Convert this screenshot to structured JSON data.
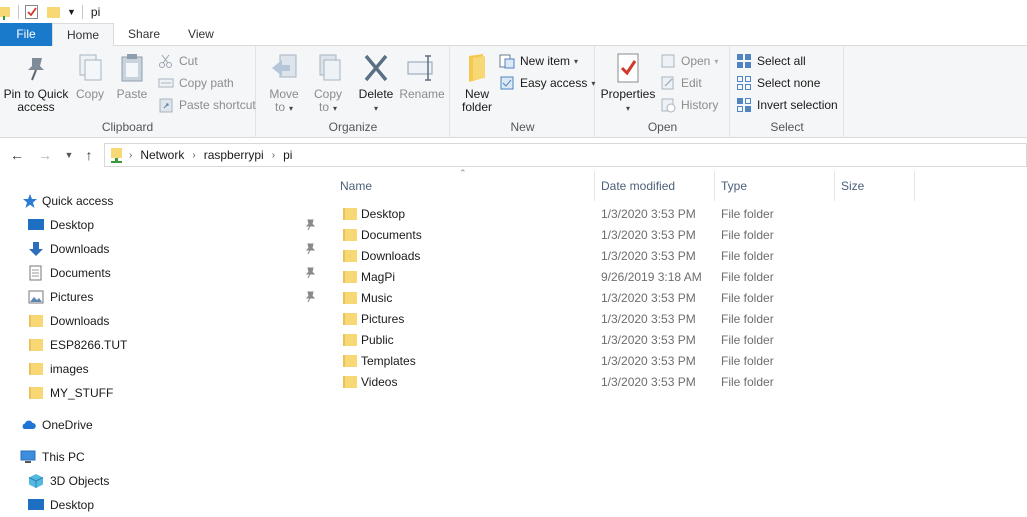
{
  "window": {
    "title": "pi"
  },
  "tabs": [
    {
      "label": "File"
    },
    {
      "label": "Home"
    },
    {
      "label": "Share"
    },
    {
      "label": "View"
    }
  ],
  "ribbon": {
    "clipboard": {
      "label": "Clipboard",
      "pin_label": "Pin to Quick access",
      "copy_label": "Copy",
      "paste_label": "Paste",
      "cut_label": "Cut",
      "copy_path_label": "Copy path",
      "paste_shortcut_label": "Paste shortcut"
    },
    "organize": {
      "label": "Organize",
      "move_label": "Move to",
      "copy_to_label": "Copy to",
      "delete_label": "Delete",
      "rename_label": "Rename"
    },
    "new": {
      "label": "New",
      "new_folder_label": "New folder",
      "new_item_label": "New item",
      "easy_access_label": "Easy access"
    },
    "open": {
      "label": "Open",
      "properties_label": "Properties",
      "open_label": "Open",
      "edit_label": "Edit",
      "history_label": "History"
    },
    "select": {
      "label": "Select",
      "select_all_label": "Select all",
      "select_none_label": "Select none",
      "invert_label": "Invert selection"
    }
  },
  "address": {
    "crumbs": [
      "Network",
      "raspberrypi",
      "pi"
    ]
  },
  "navpane": {
    "quick_access": "Quick access",
    "items": [
      {
        "label": "Desktop",
        "icon": "desktop-icon",
        "pinned": true
      },
      {
        "label": "Downloads",
        "icon": "downloads-icon",
        "pinned": true
      },
      {
        "label": "Documents",
        "icon": "documents-icon",
        "pinned": true
      },
      {
        "label": "Pictures",
        "icon": "pictures-icon",
        "pinned": true
      },
      {
        "label": "Downloads",
        "icon": "folder-icon",
        "pinned": false
      },
      {
        "label": "ESP8266.TUT",
        "icon": "folder-icon",
        "pinned": false
      },
      {
        "label": "images",
        "icon": "folder-icon",
        "pinned": false
      },
      {
        "label": "MY_STUFF",
        "icon": "folder-icon",
        "pinned": false
      }
    ],
    "onedrive": "OneDrive",
    "this_pc": "This PC",
    "pc_items": [
      {
        "label": "3D Objects",
        "icon": "3d-objects-icon"
      },
      {
        "label": "Desktop",
        "icon": "desktop-icon"
      }
    ]
  },
  "columns": {
    "name": "Name",
    "date": "Date modified",
    "type": "Type",
    "size": "Size"
  },
  "files": [
    {
      "name": "Desktop",
      "date": "1/3/2020 3:53 PM",
      "type": "File folder",
      "size": ""
    },
    {
      "name": "Documents",
      "date": "1/3/2020 3:53 PM",
      "type": "File folder",
      "size": ""
    },
    {
      "name": "Downloads",
      "date": "1/3/2020 3:53 PM",
      "type": "File folder",
      "size": ""
    },
    {
      "name": "MagPi",
      "date": "9/26/2019 3:18 AM",
      "type": "File folder",
      "size": ""
    },
    {
      "name": "Music",
      "date": "1/3/2020 3:53 PM",
      "type": "File folder",
      "size": ""
    },
    {
      "name": "Pictures",
      "date": "1/3/2020 3:53 PM",
      "type": "File folder",
      "size": ""
    },
    {
      "name": "Public",
      "date": "1/3/2020 3:53 PM",
      "type": "File folder",
      "size": ""
    },
    {
      "name": "Templates",
      "date": "1/3/2020 3:53 PM",
      "type": "File folder",
      "size": ""
    },
    {
      "name": "Videos",
      "date": "1/3/2020 3:53 PM",
      "type": "File folder",
      "size": ""
    }
  ],
  "colors": {
    "accent": "#1979ca",
    "folder": "#f8d775",
    "folder_dark": "#e0b447",
    "header_text": "#4c607a"
  }
}
